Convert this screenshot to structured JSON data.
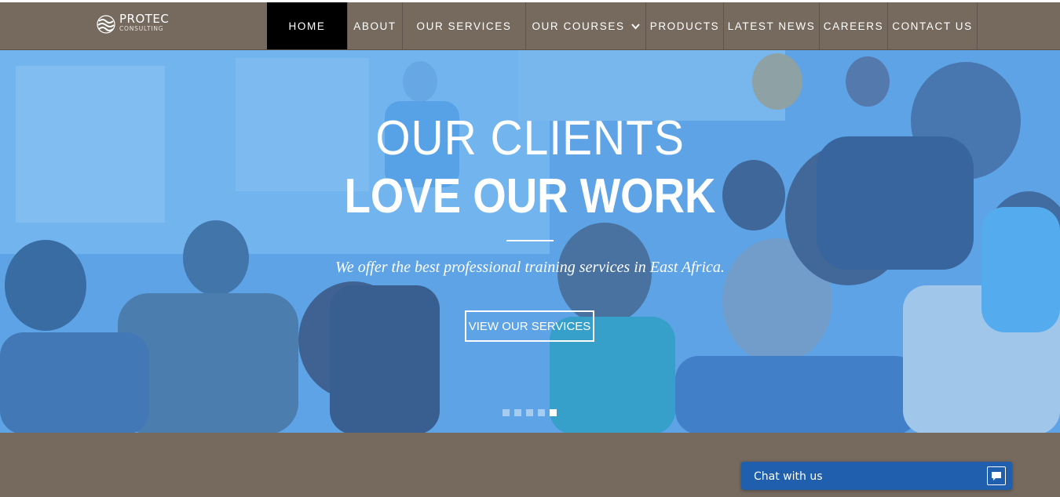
{
  "brand": {
    "name": "PROTEC",
    "subtitle": "CONSULTING",
    "icon": "protec-wave-logo"
  },
  "nav": {
    "items": [
      {
        "label": "HOME",
        "active": true
      },
      {
        "label": "ABOUT",
        "active": false
      },
      {
        "label": "OUR SERVICES",
        "active": false
      },
      {
        "label": "OUR COURSES",
        "active": false,
        "has_dropdown": true
      },
      {
        "label": "PRODUCTS",
        "active": false
      },
      {
        "label": "LATEST NEWS",
        "active": false
      },
      {
        "label": "CAREERS",
        "active": false
      },
      {
        "label": "CONTACT US",
        "active": false
      }
    ]
  },
  "hero": {
    "line1": "OUR CLIENTS",
    "line2": "LOVE OUR WORK",
    "tagline": "We offer the best professional training services in East Africa.",
    "button_label": "VIEW OUR SERVICES",
    "slide_count": 5,
    "active_slide": 5
  },
  "chat": {
    "label": "Chat with us",
    "icon": "chat-bubble-icon"
  },
  "colors": {
    "header_bg": "#766a5f",
    "nav_active_bg": "#000000",
    "hero_overlay": "#499beb",
    "chat_bg": "#1f5fae",
    "page_bg": "#766a5f"
  }
}
